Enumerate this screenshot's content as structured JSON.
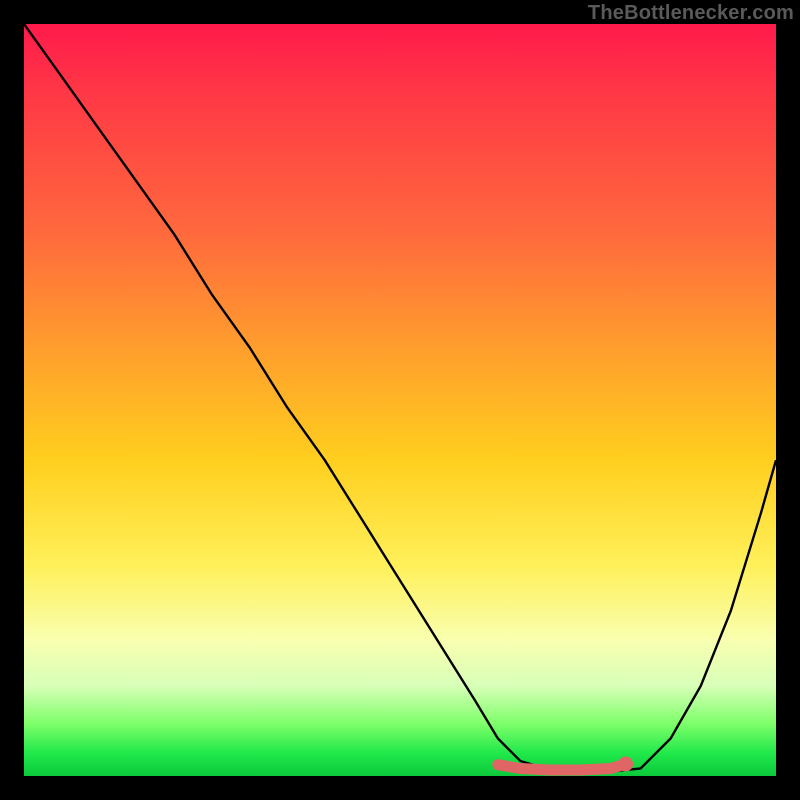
{
  "attribution": "TheBottlenecker.com",
  "chart_data": {
    "type": "line",
    "title": "",
    "xlabel": "",
    "ylabel": "",
    "xlim": [
      0,
      100
    ],
    "ylim": [
      0,
      100
    ],
    "series": [
      {
        "name": "curve",
        "x": [
          0,
          5,
          10,
          15,
          20,
          25,
          30,
          35,
          40,
          45,
          50,
          55,
          60,
          63,
          66,
          70,
          74,
          78,
          82,
          86,
          90,
          94,
          98,
          100
        ],
        "y": [
          100,
          93,
          86,
          79,
          72,
          64,
          57,
          49,
          42,
          34,
          26,
          18,
          10,
          5,
          2,
          0.8,
          0.6,
          0.6,
          1.0,
          5,
          12,
          22,
          35,
          42
        ]
      },
      {
        "name": "highlight",
        "x": [
          63,
          66,
          70,
          74,
          78,
          80
        ],
        "y": [
          1.5,
          1.0,
          0.8,
          0.8,
          1.0,
          1.6
        ]
      }
    ],
    "highlight_endpoint": {
      "x": 80,
      "y": 1.6
    },
    "colors": {
      "curve": "#000000",
      "highlight": "#e06666",
      "highlight_dot": "#e06666"
    }
  }
}
